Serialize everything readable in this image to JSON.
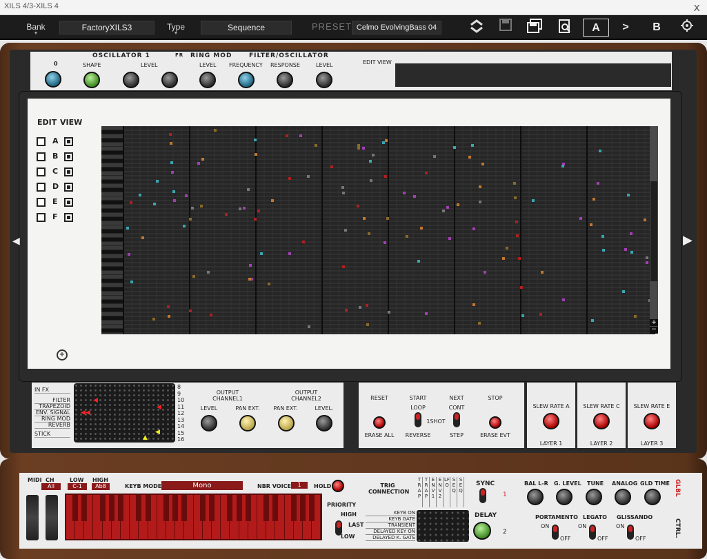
{
  "window": {
    "title": "XILS 4/3-XILS 4",
    "close": "x"
  },
  "toolbar": {
    "bank_label": "Bank",
    "bank_value": "FactoryXILS3",
    "type_label": "Type",
    "type_value": "Sequence",
    "preset_label": "PRESET",
    "preset_value": "Celmo EvolvingBass 04",
    "btn_a": "A",
    "btn_next": ">",
    "btn_b": "B"
  },
  "strip": {
    "osc_title": "OSCILLATOR 1",
    "shape": "SHAPE",
    "level": "LEVEL",
    "fr": "FR",
    "ring_title": "RING MOD",
    "ring_level": "LEVEL",
    "filter_title": "FILTER/OSCILLATOR",
    "frequency": "FREQUENCY",
    "response": "RESPONSE",
    "filter_level": "LEVEL",
    "edit_view": "EDIT VIEW",
    "osc_zero": "0"
  },
  "edit_view": {
    "edit_label": "EDIT",
    "view_label": "VIEW",
    "rows": [
      "A",
      "B",
      "C",
      "D",
      "E",
      "F"
    ],
    "zoom_plus": "+",
    "zoom_minus": "−"
  },
  "routing": {
    "items": [
      "IN FX",
      "FILTER",
      "TRAPEZOID",
      "ENV. SIGNAL",
      "RING MOD",
      "REVERB",
      "STICK"
    ],
    "numbers": [
      "8",
      "9",
      "10",
      "11",
      "12",
      "13",
      "14",
      "15",
      "16"
    ]
  },
  "output": {
    "ch1": "OUTPUT CHANNEL1",
    "ch2": "OUTPUT CHANNEL2",
    "level": "LEVEL",
    "pan1": "PAN EXT.",
    "pan2": "PAN EXT.",
    "level2": "LEVEL."
  },
  "sequencer": {
    "reset": "RESET",
    "start": "START",
    "next": "NEXT",
    "stop": "STOP",
    "loop": "LOOP",
    "oneshot": "1SHOT",
    "cont": "CONT",
    "erase_all": "ERASE ALL",
    "reverse": "REVERSE",
    "step": "STEP",
    "erase_evt": "ERASE EVT"
  },
  "slew": [
    {
      "label": "SLEW RATE A",
      "layer": "LAYER 1"
    },
    {
      "label": "SLEW RATE C",
      "layer": "LAYER 2"
    },
    {
      "label": "SLEW RATE E",
      "layer": "LAYER 3"
    }
  ],
  "keys": {
    "midi": "MIDI",
    "ch": "CH",
    "ch_value": "All",
    "low": "LOW",
    "low_value": "C-1",
    "high": "HIGH",
    "high_value": "Ab8",
    "keyb_mode": "KEYB MODE",
    "keyb_mode_value": "Mono",
    "nbr_voices": "NBR VOICES",
    "nbr_voices_value": "1",
    "hold": "HOLD",
    "priority": "PRIORITY",
    "high_p": "HIGH",
    "last": "LAST",
    "low_p": "LOW",
    "trig": "TRIG CONNECTION",
    "trig_list": [
      "KEYB ON",
      "KEYB GATE",
      "TRANSIENT",
      "DELAYED KEY ON",
      "DELAYED K. GATE"
    ],
    "trig_cols": [
      "TRAP",
      "TRAP",
      "ENV1",
      "ENV2",
      "LFO",
      "SEQ",
      "SEQ"
    ],
    "sync": "SYNC",
    "delay": "DELAY",
    "one": "1",
    "two": "2",
    "bal": "BAL L-R",
    "glevel": "G. LEVEL",
    "tune": "TUNE",
    "analog": "ANALOG",
    "gld_time": "GLD TIME",
    "glbl": "GLBL",
    "ctrl": "CTRL.",
    "portamento": "PORTAMENTO",
    "legato": "LEGATO",
    "glissando": "GLISSANDO",
    "on": "ON",
    "off": "OFF"
  }
}
